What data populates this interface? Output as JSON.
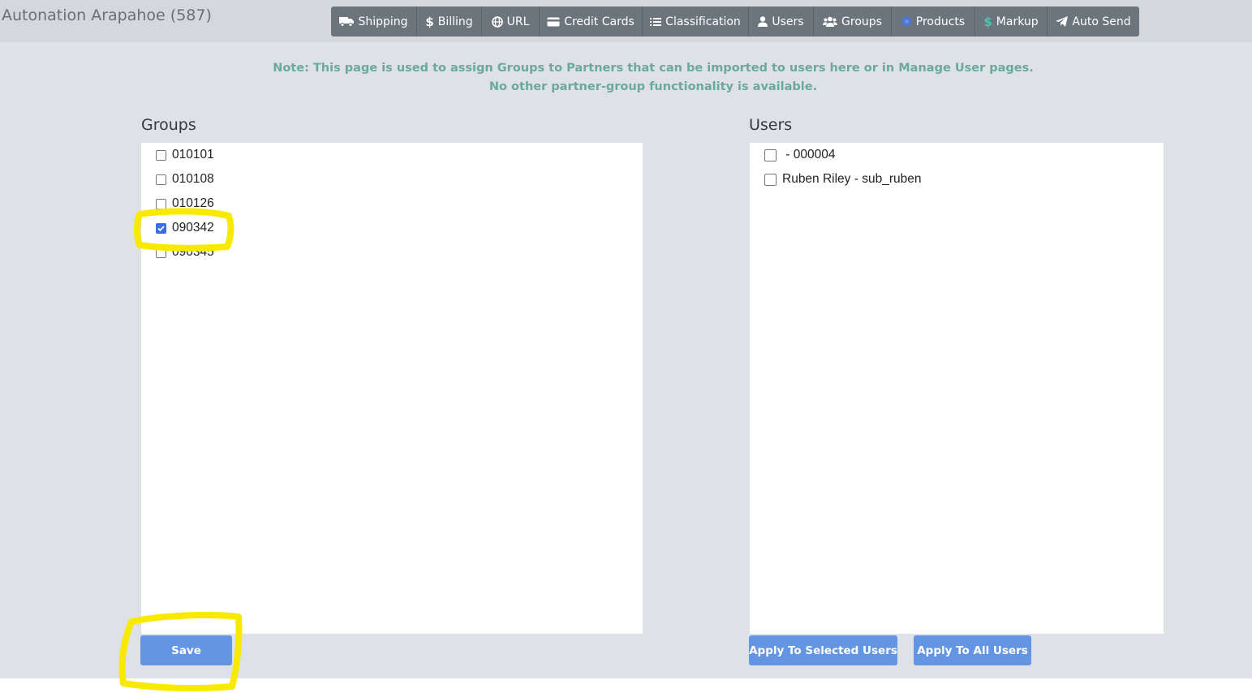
{
  "header": {
    "partner_title": "Autonation Arapahoe (587)"
  },
  "nav": {
    "items": [
      {
        "label": "Shipping",
        "icon": "truck-icon"
      },
      {
        "label": "Billing",
        "icon": "dollar-icon"
      },
      {
        "label": "URL",
        "icon": "globe-icon"
      },
      {
        "label": "Credit Cards",
        "icon": "credit-card-icon"
      },
      {
        "label": "Classification",
        "icon": "list-icon"
      },
      {
        "label": "Users",
        "icon": "user-icon"
      },
      {
        "label": "Groups",
        "icon": "users-icon"
      },
      {
        "label": "Products",
        "icon": "product-circle-icon"
      },
      {
        "label": "Markup",
        "icon": "dollar-icon"
      },
      {
        "label": "Auto Send",
        "icon": "paper-plane-icon"
      }
    ]
  },
  "note": {
    "line1": "Note: This page is used to assign Groups to Partners that can be imported to users here or in Manage User pages.",
    "line2": "No other partner-group functionality is available."
  },
  "groups": {
    "title": "Groups",
    "items": [
      {
        "label": "010101",
        "checked": false
      },
      {
        "label": "010108",
        "checked": false
      },
      {
        "label": "010126",
        "checked": false
      },
      {
        "label": "090342",
        "checked": true
      },
      {
        "label": "090345",
        "checked": false
      }
    ],
    "save_label": "Save"
  },
  "users": {
    "title": "Users",
    "items": [
      {
        "label": " - 000004",
        "checked": false
      },
      {
        "label": "Ruben Riley - sub_ruben",
        "checked": false
      }
    ],
    "apply_selected_label": "Apply To Selected Users",
    "apply_all_label": "Apply To All Users"
  },
  "colors": {
    "nav_bg": "#6c757d",
    "note_text": "#6aa9a0",
    "button_bg": "#6495e3",
    "checkbox_checked": "#3b6fe0",
    "highlight": "#f7ea00"
  }
}
